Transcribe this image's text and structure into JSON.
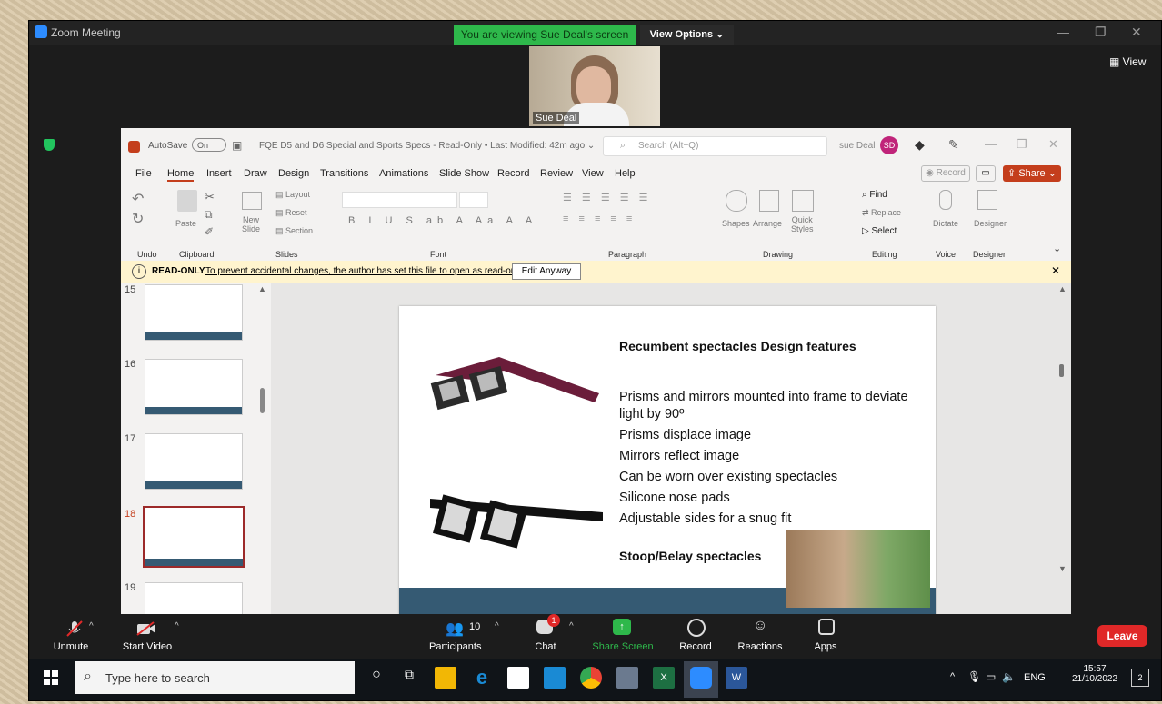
{
  "zoom": {
    "window_title": "Zoom Meeting",
    "viewing_banner": "You are viewing Sue Deal's screen",
    "view_options": "View Options ⌄",
    "view_label": "View",
    "participant_name": "Sue Deal"
  },
  "ppt": {
    "autosave_label": "AutoSave",
    "autosave_state": "On",
    "file_title": "FQE D5 and D6 Special and Sports Specs  -  Read-Only  •  Last Modified: 42m ago ⌄",
    "search_placeholder": "Search (Alt+Q)",
    "user_name": "sue Deal",
    "user_initials": "SD",
    "menu": [
      "File",
      "Home",
      "Insert",
      "Draw",
      "Design",
      "Transitions",
      "Animations",
      "Slide Show",
      "Record",
      "Review",
      "View",
      "Help"
    ],
    "record_button": "Record",
    "share_button": "Share",
    "ribbon_groups": [
      "Undo",
      "Clipboard",
      "Slides",
      "Font",
      "Paragraph",
      "Drawing",
      "Editing",
      "Voice",
      "Designer"
    ],
    "ribbon_buttons": {
      "paste": "Paste",
      "new_slide": "New\nSlide",
      "layout": "Layout",
      "reset": "Reset",
      "section": "Section",
      "shapes": "Shapes",
      "arrange": "Arrange",
      "quick_styles": "Quick\nStyles",
      "find": "Find",
      "replace": "Replace",
      "select": "Select",
      "dictate": "Dictate",
      "designer": "Designer"
    },
    "readonly_label": "READ-ONLY",
    "readonly_message": "To prevent accidental changes, the author has set this file to open as read-only.",
    "edit_anyway": "Edit Anyway",
    "slide_numbers": [
      "15",
      "16",
      "17",
      "18",
      "19"
    ],
    "slide": {
      "heading": "Recumbent spectacles Design features",
      "bullets": [
        "Prisms and mirrors mounted into frame to deviate light by 90º",
        "Prisms displace image",
        "Mirrors reflect image",
        "Can be worn over existing spectacles",
        "Silicone nose pads",
        "Adjustable sides for a snug fit"
      ],
      "subheading": "Stoop/Belay spectacles"
    }
  },
  "controls": {
    "unmute": "Unmute",
    "start_video": "Start Video",
    "participants": "Participants",
    "participants_count": "10",
    "chat": "Chat",
    "chat_badge": "1",
    "share_screen": "Share Screen",
    "record": "Record",
    "reactions": "Reactions",
    "apps": "Apps",
    "leave": "Leave"
  },
  "taskbar": {
    "search_placeholder": "Type here to search",
    "lang": "ENG",
    "time": "15:57",
    "date": "21/10/2022",
    "notification_count": "2"
  },
  "colors": {
    "zoom_green": "#2eb84b",
    "ppt_red": "#c43e1c",
    "leave_red": "#e02828",
    "slide_footer": "#355a73"
  }
}
